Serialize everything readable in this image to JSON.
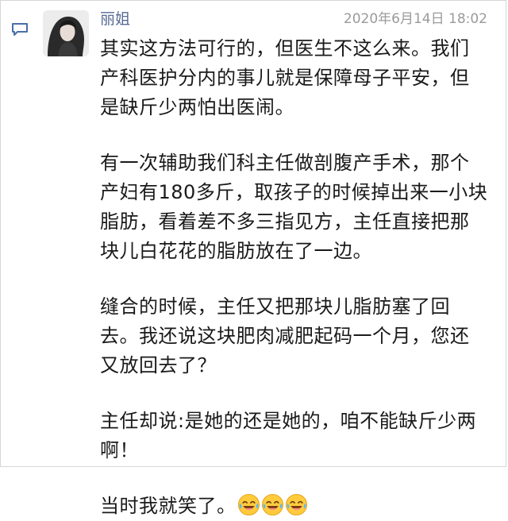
{
  "post": {
    "username": "丽姐",
    "timestamp": "2020年6月14日 18:02",
    "paragraphs": [
      [
        "其实这方法可行的，但医生不这么来。我们",
        "产科医护分内的事儿就是保障母子平安，但",
        "是缺斤少两怕出医闹。"
      ],
      [
        "有一次辅助我们科主任做剖腹产手术，那个",
        "产妇有180多斤，取孩子的时候掉出来一小块",
        "脂肪，看着差不多三指见方，主任直接把那",
        "块儿白花花的脂肪放在了一边。"
      ],
      [
        "缝合的时候，主任又把那块儿脂肪塞了回",
        "去。我还说这块肥肉减肥起码一个月，您还",
        "又放回去了？"
      ],
      [
        "主任却说:是她的还是她的，咱不能缺斤少两",
        "啊！"
      ]
    ],
    "last_line": "当时我就笑了。",
    "emojis": [
      "laugh-cry-emoji",
      "laugh-cry-emoji",
      "laugh-cry-emoji"
    ]
  },
  "icons": {
    "comment": "comment-icon",
    "avatar": "avatar"
  },
  "colors": {
    "username": "#576b95",
    "timestamp": "#9a9a9a",
    "text": "#1a1a1a",
    "icon": "#4a6fa5"
  }
}
